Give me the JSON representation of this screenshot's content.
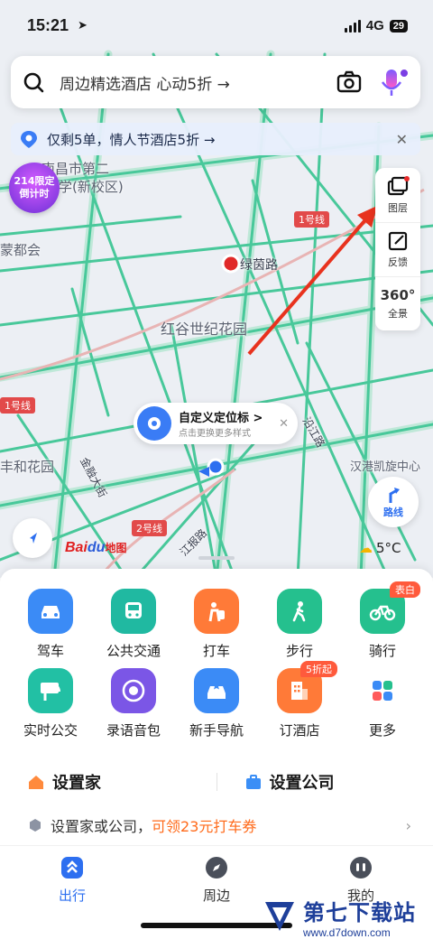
{
  "status_bar": {
    "time": "15:21",
    "network": "4G",
    "battery": "29"
  },
  "search": {
    "text": "周边精选酒店 心动5折 →"
  },
  "banner": {
    "text": "仅剩5单，情人节酒店5折 →"
  },
  "countdown": {
    "line1": "214限定",
    "line2": "倒计时"
  },
  "map_labels": {
    "school": "南昌市第二",
    "school2": "中学(新校区)",
    "temple": "蒙都会",
    "station": "绿茵路",
    "garden": "红谷世纪花园",
    "road_jinlong": "金融大街",
    "road_jiangbao": "江报路",
    "road_yanjiang": "沿江路",
    "hotel": "汉港凯旋中心",
    "fenghe": "丰和花园",
    "line1": "1号线",
    "line1b": "1号线",
    "line2": "2号线",
    "line2b": "2号线"
  },
  "tools": [
    {
      "label": "图层",
      "icon": "layers-icon"
    },
    {
      "label": "反馈",
      "icon": "feedback-icon"
    },
    {
      "label": "全景",
      "icon": "panorama-icon",
      "glyph": "360°"
    }
  ],
  "custom_location": {
    "title": "自定义定位标 >",
    "subtitle": "点击更换更多样式"
  },
  "route_button": {
    "label": "路线"
  },
  "baidu_logo": {
    "bai": "Bai",
    "du": "du",
    "map": "地图"
  },
  "weather": {
    "temp": "5°C"
  },
  "grid_row1": [
    {
      "label": "驾车",
      "icon": "car-icon",
      "color": "#3b8bf6"
    },
    {
      "label": "公共交通",
      "icon": "bus-icon",
      "color": "#20b9a1"
    },
    {
      "label": "打车",
      "icon": "taxi-icon",
      "color": "#ff7a38"
    },
    {
      "label": "步行",
      "icon": "walk-icon",
      "color": "#25c08e"
    },
    {
      "label": "骑行",
      "icon": "bike-icon",
      "color": "#25c08e",
      "badge": "表白"
    }
  ],
  "grid_row2": [
    {
      "label": "实时公交",
      "icon": "realtime-bus-icon",
      "color": "#22c0a4"
    },
    {
      "label": "录语音包",
      "icon": "voice-pack-icon",
      "color": "#7b56e6"
    },
    {
      "label": "新手导航",
      "icon": "nav-guide-icon",
      "color": "#3b8bf6"
    },
    {
      "label": "订酒店",
      "icon": "hotel-icon",
      "color": "#ff7a38",
      "badge": "5折起"
    },
    {
      "label": "更多",
      "icon": "more-icon",
      "color": "#ffffff"
    }
  ],
  "set_home": {
    "label": "设置家"
  },
  "set_company": {
    "label": "设置公司"
  },
  "promo": {
    "text": "设置家或公司，",
    "highlight": "可领23元打车券"
  },
  "tabs": [
    {
      "label": "出行",
      "icon": "travel-icon",
      "active": true
    },
    {
      "label": "周边",
      "icon": "compass-icon",
      "active": false
    },
    {
      "label": "我的",
      "icon": "profile-icon",
      "active": false
    }
  ],
  "watermark": {
    "brand": "第七下载站",
    "url": "www.d7down.com"
  }
}
